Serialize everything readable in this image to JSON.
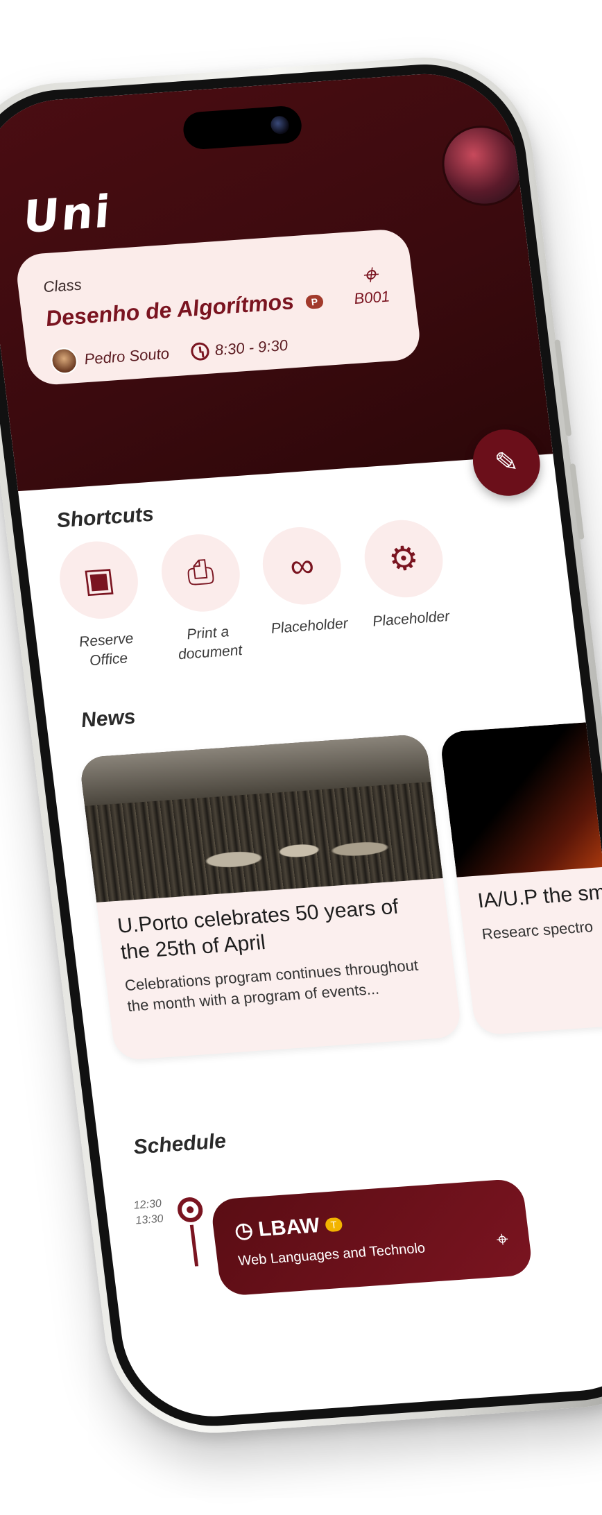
{
  "app": {
    "logo_text": "Uni"
  },
  "class_card": {
    "label": "Class",
    "course": "Desenho de Algorítmos",
    "type_badge": "P",
    "teacher": "Pedro Souto",
    "time": "8:30 - 9:30",
    "room": "B001"
  },
  "shortcuts": {
    "title": "Shortcuts",
    "items": [
      {
        "label": "Reserve Office",
        "icon": "reserve-icon"
      },
      {
        "label": "Print a document",
        "icon": "printer-icon"
      },
      {
        "label": "Placeholder",
        "icon": "link-icon"
      },
      {
        "label": "Placeholder",
        "icon": "gear-icon"
      }
    ]
  },
  "news": {
    "title": "News",
    "items": [
      {
        "title": "U.Porto celebrates 50 years of the 25th of April",
        "summary": "Celebrations program continues throughout the month with a program of events..."
      },
      {
        "title": "IA/U.P the sm",
        "summary": "Researc spectro"
      }
    ]
  },
  "schedule": {
    "title": "Schedule",
    "items": [
      {
        "start": "12:30",
        "end": "13:30",
        "code": "LBAW",
        "badge": "T",
        "subject": "Web Languages and Technolo"
      }
    ]
  },
  "colors": {
    "brand": "#6b0f1a",
    "card_bg": "#fbecea",
    "badge_p": "#a23a2c",
    "badge_t": "#f2b400"
  }
}
